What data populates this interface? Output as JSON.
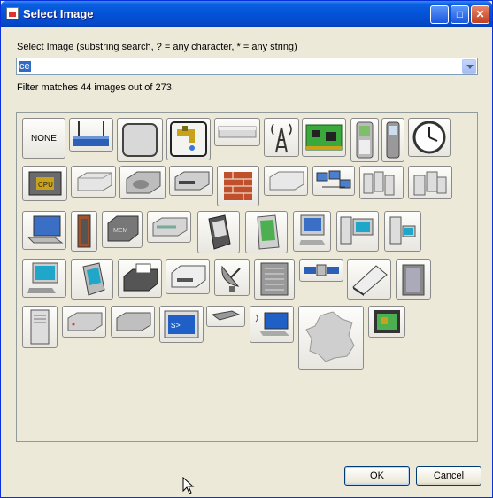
{
  "window": {
    "title": "Select Image",
    "app_icon": "image-icon"
  },
  "titlebar_buttons": [
    "minimize-icon",
    "maximize-icon",
    "close-icon"
  ],
  "search": {
    "label": "Select Image (substring search, ? = any character, * = any string)",
    "value": "ce"
  },
  "status": "Filter matches 44 images out of 273.",
  "images": [
    {
      "name": "none",
      "label": "NONE"
    },
    {
      "name": "router-icon"
    },
    {
      "name": "blank-shape-icon"
    },
    {
      "name": "water-tap-icon"
    },
    {
      "name": "hub-icon"
    },
    {
      "name": "antenna-tower-icon"
    },
    {
      "name": "circuit-board-icon"
    },
    {
      "name": "mobile-phone-icon"
    },
    {
      "name": "cell-phone-icon"
    },
    {
      "name": "clock-icon"
    },
    {
      "name": "cpu-icon"
    },
    {
      "name": "network-device-icon"
    },
    {
      "name": "hard-disk-icon"
    },
    {
      "name": "tape-drive-icon"
    },
    {
      "name": "firewall-icon"
    },
    {
      "name": "switch-icon"
    },
    {
      "name": "network-group-icon"
    },
    {
      "name": "server-cluster-icon"
    },
    {
      "name": "server-group-icon"
    },
    {
      "name": "laptop-icon"
    },
    {
      "name": "rack-server-icon"
    },
    {
      "name": "memory-module-icon"
    },
    {
      "name": "modem-icon"
    },
    {
      "name": "pda-icon"
    },
    {
      "name": "tablet-icon"
    },
    {
      "name": "workstation-icon"
    },
    {
      "name": "desktop-computer-icon"
    },
    {
      "name": "desktop-tower-icon"
    },
    {
      "name": "pc-icon"
    },
    {
      "name": "pocket-pc-icon"
    },
    {
      "name": "fax-machine-icon"
    },
    {
      "name": "printer-icon"
    },
    {
      "name": "satellite-dish-icon"
    },
    {
      "name": "mainframe-icon"
    },
    {
      "name": "satellite-icon"
    },
    {
      "name": "scanner-icon"
    },
    {
      "name": "server-cabinet-icon"
    },
    {
      "name": "tower-server-icon"
    },
    {
      "name": "nas-device-icon"
    },
    {
      "name": "storage-unit-icon"
    },
    {
      "name": "terminal-icon"
    },
    {
      "name": "usb-stick-icon"
    },
    {
      "name": "wireless-laptop-icon"
    },
    {
      "name": "france-map-icon"
    },
    {
      "name": "network-card-icon"
    }
  ],
  "buttons": {
    "ok": "OK",
    "cancel": "Cancel"
  },
  "cursor": "mouse-pointer-icon"
}
